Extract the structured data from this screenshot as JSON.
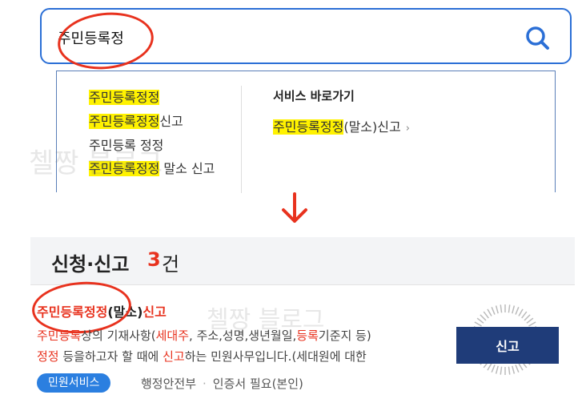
{
  "search": {
    "value": "주민등록정"
  },
  "dropdown": {
    "suggestions": [
      {
        "highlight": "주민등록정정",
        "rest": ""
      },
      {
        "highlight": "주민등록정정",
        "rest": "신고"
      },
      {
        "highlight": "",
        "rest": "주민등록 정정"
      },
      {
        "highlight": "주민등록정정",
        "rest": " 말소 신고"
      }
    ],
    "shortcut_title": "서비스 바로가기",
    "shortcut_link": {
      "highlight": "주민등록정정",
      "rest": "(말소)신고",
      "chevron": "›"
    }
  },
  "watermark": "첼짱 블로그",
  "results": {
    "title": "신청·신고",
    "count": "3",
    "unit": "건",
    "item": {
      "title_highlight": "주민등록정정",
      "title_mid": "(말소)",
      "title_end": "신고",
      "desc1": {
        "a": "주민등록",
        "b": "상의 기재사항(",
        "c": "세대주",
        "d": ", 주소,성명,생년월일,",
        "e": "등록",
        "f": "기준지 등)"
      },
      "desc2": {
        "a": "정정",
        "b": " 등을하고자 할 때에 ",
        "c": "신고",
        "d": "하는 민원사무입니다.(세대원에 대한"
      },
      "badge": "민원서비스",
      "agency": "행정안전부",
      "separator": "·",
      "cert": "인증서 필요(본인)",
      "button": "신고"
    }
  },
  "colors": {
    "accent_blue": "#2b6fd6",
    "highlight_red": "#e8321e",
    "highlight_yellow": "#fff200",
    "button_navy": "#1f3c79"
  }
}
